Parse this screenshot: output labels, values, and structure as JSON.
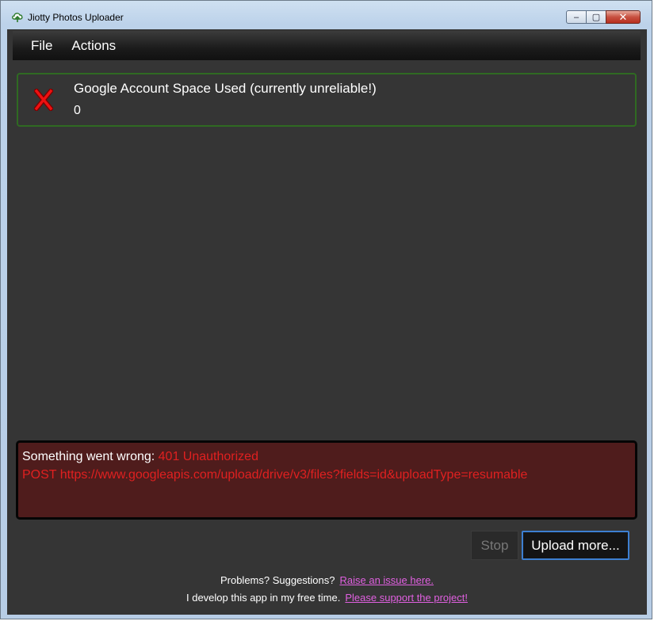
{
  "window": {
    "title": "Jiotty Photos Uploader",
    "icon": "upload-cloud-icon",
    "controls": {
      "minimize": "–",
      "maximize": "▢",
      "close": "✕"
    }
  },
  "menu": {
    "items": [
      "File",
      "Actions"
    ]
  },
  "status_card": {
    "icon": "error-x-icon",
    "title": "Google Account Space Used (currently unreliable!)",
    "value": "0",
    "border_color": "#2f6a22"
  },
  "error": {
    "prefix": "Something went wrong: ",
    "code": "401 Unauthorized",
    "request": "POST https://www.googleapis.com/upload/drive/v3/files?fields=id&uploadType=resumable",
    "color": "#e02020"
  },
  "buttons": {
    "stop": "Stop",
    "upload_more": "Upload more..."
  },
  "footer": {
    "line1_text": "Problems? Suggestions?",
    "line1_link": "Raise an issue here.",
    "line2_text": "I develop this app in my free time.",
    "line2_link": "Please support the project!",
    "link_color": "#e060e0"
  }
}
